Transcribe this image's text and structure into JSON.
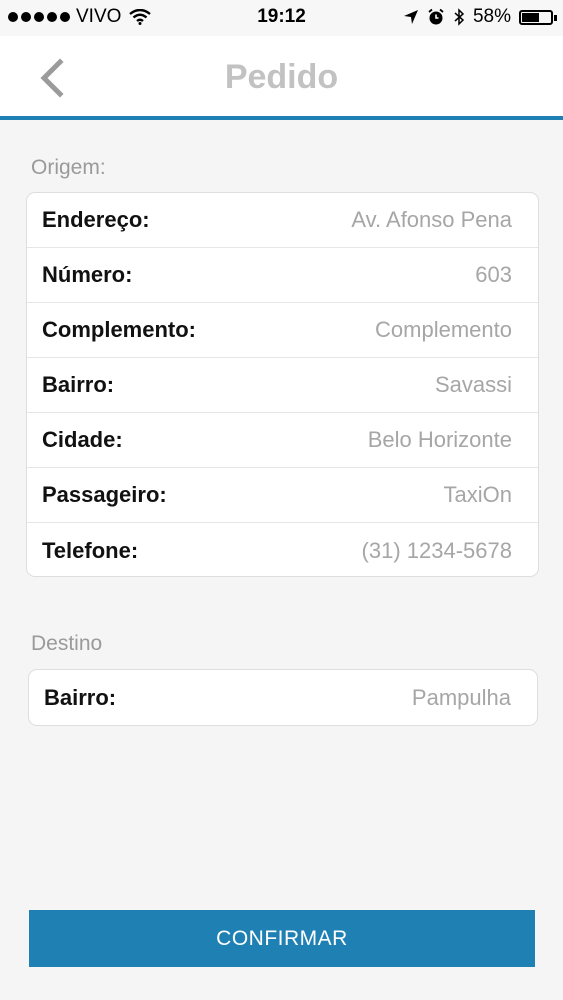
{
  "status_bar": {
    "carrier": "VIVO",
    "time": "19:12",
    "battery": "58%",
    "battery_level": 0.58
  },
  "nav": {
    "title": "Pedido",
    "back_icon": "chevron-left-icon"
  },
  "origem": {
    "label": "Origem:",
    "fields": [
      {
        "label": "Endereço:",
        "value": "Av. Afonso Pena"
      },
      {
        "label": "Número:",
        "value": "603"
      },
      {
        "label": "Complemento:",
        "value": "Complemento"
      },
      {
        "label": "Bairro:",
        "value": "Savassi"
      },
      {
        "label": "Cidade:",
        "value": "Belo Horizonte"
      },
      {
        "label": "Passageiro:",
        "value": "TaxiOn"
      },
      {
        "label": "Telefone:",
        "value": "(31) 1234-5678"
      }
    ]
  },
  "destino": {
    "label": "Destino",
    "fields": [
      {
        "label": "Bairro:",
        "value": "Pampulha"
      }
    ]
  },
  "actions": {
    "confirm_label": "CONFIRMAR"
  },
  "colors": {
    "accent": "#1f80b4",
    "background": "#f5f5f6",
    "placeholder": "#a6a6a6"
  }
}
